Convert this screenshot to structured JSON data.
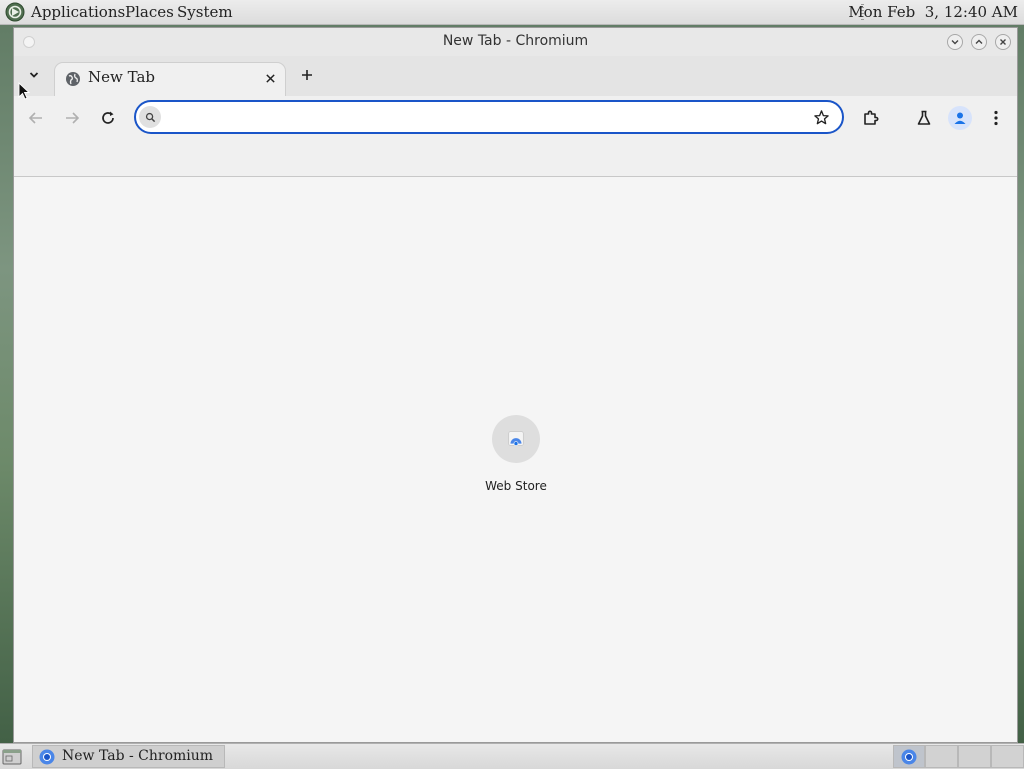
{
  "top_panel": {
    "menus": [
      "Applications",
      "Places",
      "System"
    ],
    "clock": "Mon Feb  3, 12:40 AM"
  },
  "window": {
    "title": "New Tab - Chromium"
  },
  "tabstrip": {
    "active_tab_title": "New Tab"
  },
  "toolbar": {
    "omnibox_value": "",
    "omnibox_placeholder": ""
  },
  "content": {
    "shortcuts": [
      {
        "label": "Web Store",
        "icon": "web-store-icon"
      }
    ]
  },
  "taskbar": {
    "items": [
      {
        "label": "New Tab - Chromium",
        "icon": "chromium-icon"
      }
    ],
    "workspaces": 4,
    "active_workspace": 1
  },
  "colors": {
    "omnibox_border": "#1a55c8",
    "accent_blue": "#1a73e8"
  }
}
